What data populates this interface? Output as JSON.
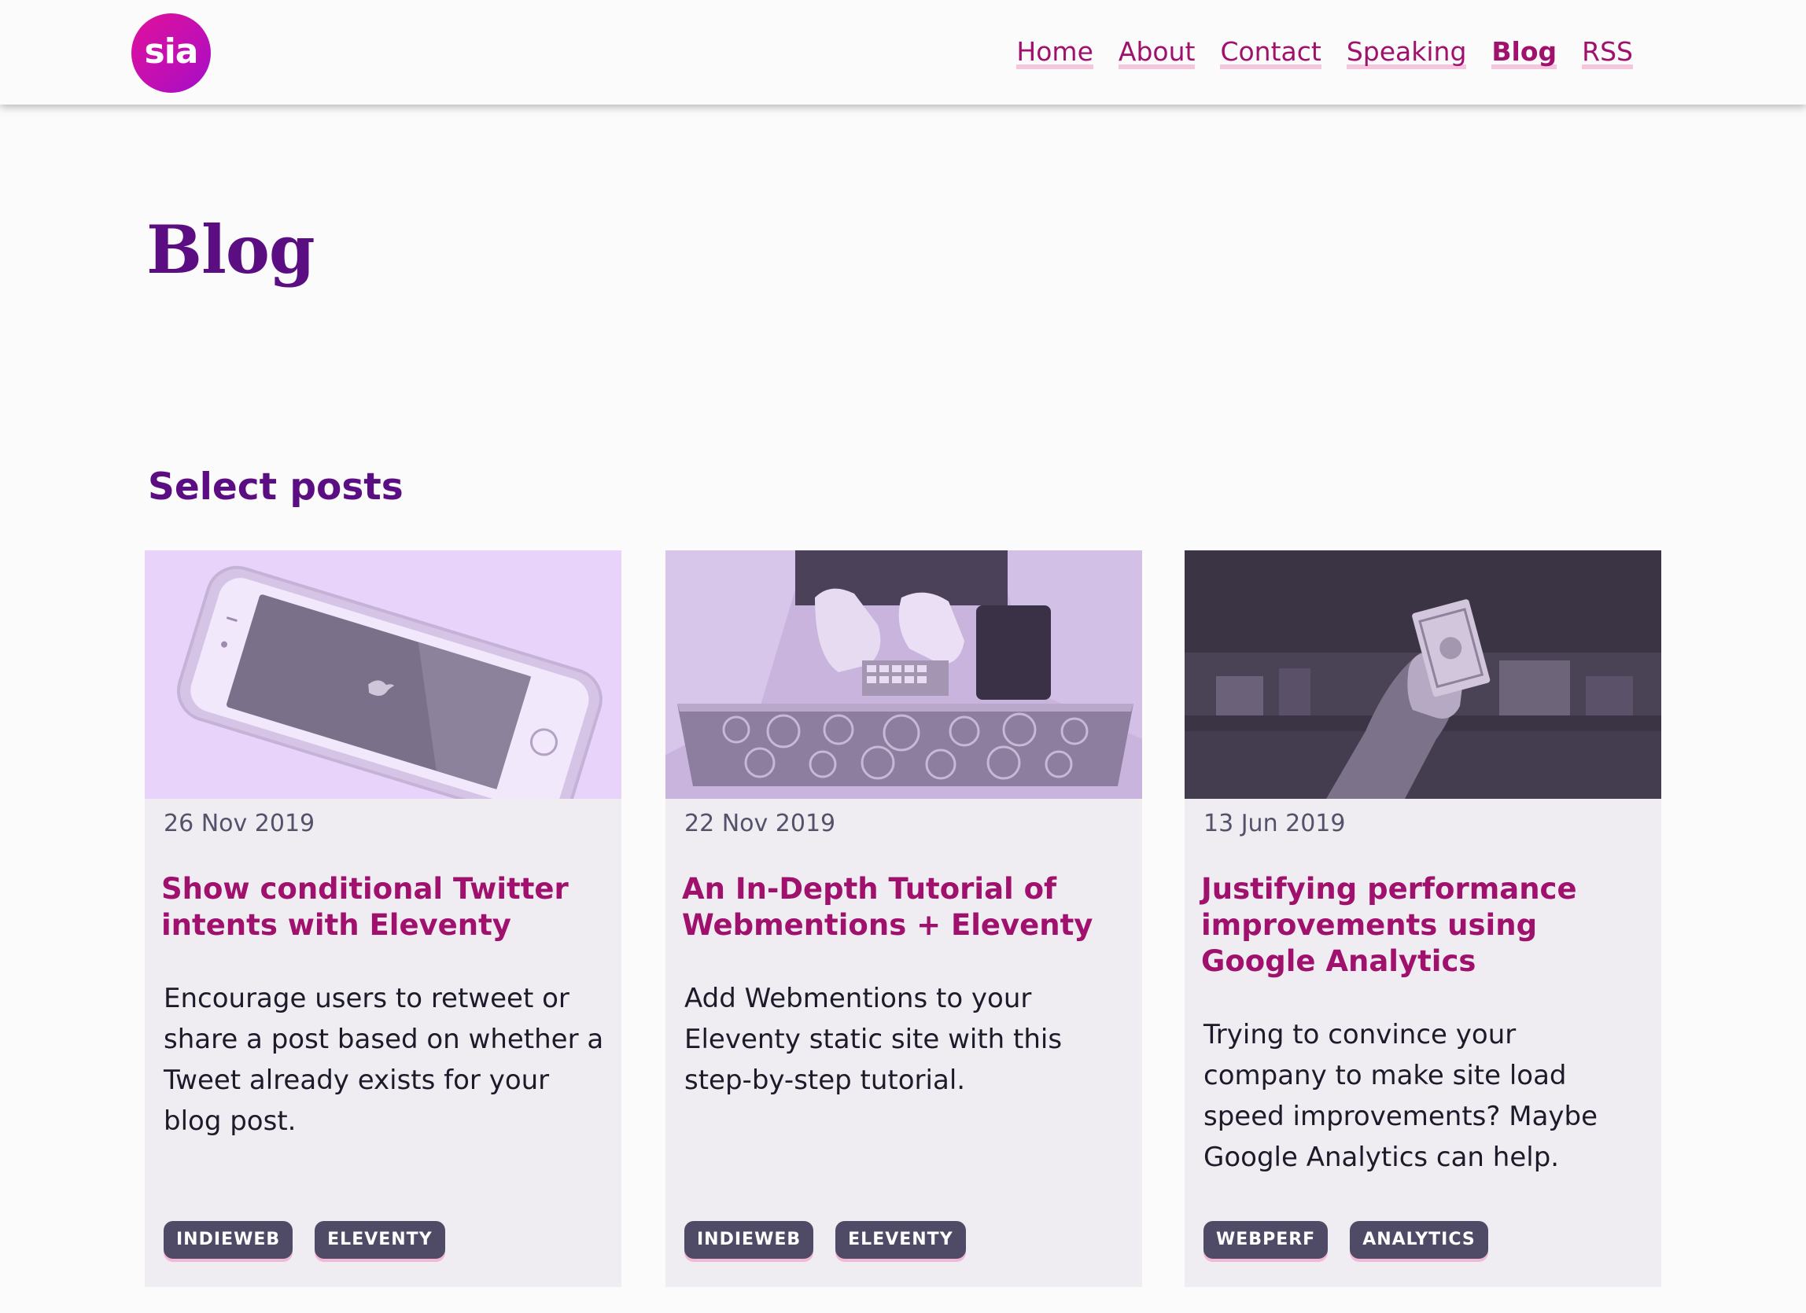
{
  "header": {
    "logo_text": "sia",
    "nav": [
      {
        "label": "Home"
      },
      {
        "label": "About"
      },
      {
        "label": "Contact"
      },
      {
        "label": "Speaking"
      },
      {
        "label": "Blog",
        "active": true
      },
      {
        "label": "RSS"
      }
    ]
  },
  "main": {
    "title": "Blog",
    "section_title": "Select posts",
    "posts": [
      {
        "image": "phone-twitter-photo",
        "date": "26 Nov 2019",
        "title": "Show conditional Twitter intents with Eleventy",
        "excerpt": "Encourage users to retweet or share a post based on whether a Tweet already exists for your blog post.",
        "tags": [
          "INDIEWEB",
          "ELEVENTY"
        ]
      },
      {
        "image": "laptop-typing-photo",
        "date": "22 Nov 2019",
        "title": "An In-Depth Tutorial of Webmentions + Eleventy",
        "excerpt": "Add Webmentions to your Eleventy static site with this step-by-step tutorial.",
        "tags": [
          "INDIEWEB",
          "ELEVENTY"
        ]
      },
      {
        "image": "hand-holding-money-photo",
        "date": "13 Jun 2019",
        "title": "Justifying performance improvements using Google Analytics",
        "excerpt": "Trying to convince your company to make site load speed improvements? Maybe Google Analytics can help.",
        "tags": [
          "WEBPERF",
          "ANALYTICS"
        ]
      }
    ]
  },
  "colors": {
    "brand_magenta": "#a0106d",
    "heading_purple": "#5b0d82",
    "card_bg": "#efedf2",
    "tag_bg": "#4f4b66",
    "underline_pink": "#f6c6de"
  }
}
